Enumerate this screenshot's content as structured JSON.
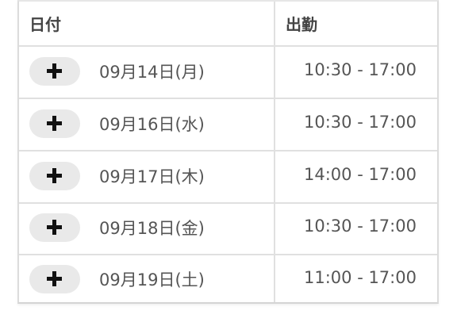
{
  "table": {
    "headers": {
      "date": "日付",
      "work": "出勤"
    },
    "rows": [
      {
        "date": "09月14日(月)",
        "time": "10:30 - 17:00"
      },
      {
        "date": "09月16日(水)",
        "time": "10:30 - 17:00"
      },
      {
        "date": "09月17日(木)",
        "time": "14:00 - 17:00"
      },
      {
        "date": "09月18日(金)",
        "time": "10:30 - 17:00"
      },
      {
        "date": "09月19日(土)",
        "time": "11:00 - 17:00"
      }
    ]
  },
  "icons": {
    "add": "plus-icon"
  },
  "colors": {
    "border": "#e0e0e0",
    "button_bg": "#e9e9e9",
    "text": "#555555",
    "header_text": "#444444"
  }
}
